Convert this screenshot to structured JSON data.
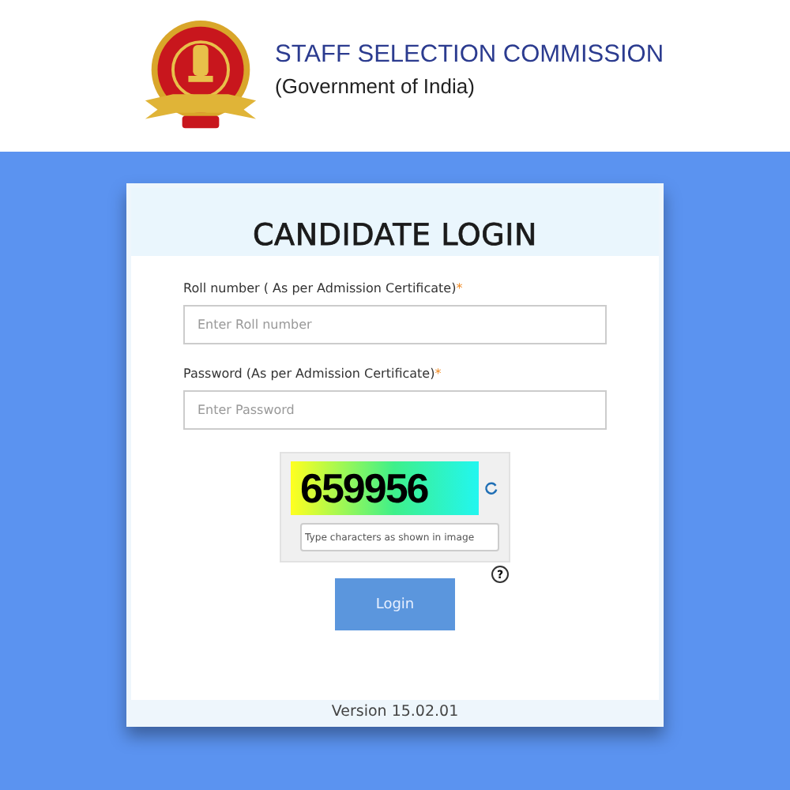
{
  "header": {
    "title": "STAFF SELECTION COMMISSION",
    "subtitle": "(Government of India)"
  },
  "login": {
    "title": "CANDIDATE LOGIN",
    "fields": [
      {
        "label": "Roll number ( As per Admission Certificate)",
        "required_mark": "*",
        "placeholder": "Enter Roll number"
      },
      {
        "label": "Password (As per Admission Certificate)",
        "required_mark": "*",
        "placeholder": "Enter Password"
      }
    ],
    "captcha": {
      "code": "659956",
      "placeholder": "Type characters as shown in image",
      "help": "?"
    },
    "button": "Login",
    "version": "Version 15.02.01"
  }
}
